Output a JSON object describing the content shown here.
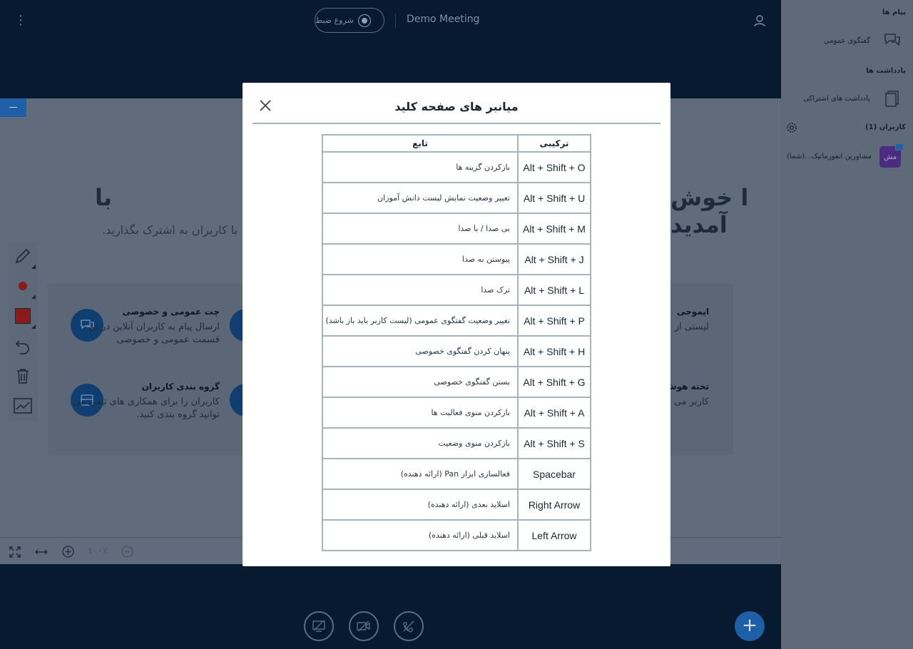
{
  "header": {
    "meeting_title": "Demo Meeting",
    "record_label": "شروع ضبط"
  },
  "stage": {
    "minimize_label": "—",
    "welcome_left": "با",
    "welcome_right": "ا خوش آمدید",
    "welcome_sub": "با کاربران به اشترک بگذارید.",
    "features": {
      "chat_title": "چت عمومی و خصوصی",
      "chat_text": "ارسال پیام به کاربران آنلاین در دو قسمت عمومی و خصوصی",
      "group_title": "گروه بندی کاربران",
      "group_text": "کاربران را برای همکاری های تیمی می توانید گروه بندی کنید.",
      "emoji_title": "ایموجی",
      "emoji_text": "لیستی از ... مختلف ... وضعیت ک...",
      "board_title": "تخته هوش...",
      "board_text": "کاربر می ... همزمان ... محتوایی ..."
    }
  },
  "zoombar": {
    "zoom_value": "۱۰۰٪"
  },
  "panel": {
    "messages_header": "پیام ها",
    "public_chat": "گفتگوی عمومی",
    "notes_header": "یادداشت ها",
    "shared_notes": "یادداشت های اشتراکی",
    "users_header": "کاربران (1)",
    "user_name": "مشاورین انفورماتیک...(شما)",
    "user_initials": "مش"
  },
  "modal": {
    "title": "میانبر های صفحه کلید",
    "col_combo": "ترکیبی",
    "col_function": "تابع",
    "rows": [
      {
        "combo": "Alt + Shift + O",
        "func": "بازکردن گزینه ها"
      },
      {
        "combo": "Alt + Shift + U",
        "func": "تغییر وضعیت نمایش لیست دانش آموزان"
      },
      {
        "combo": "Alt + Shift + M",
        "func": "بی صدا / با صدا"
      },
      {
        "combo": "Alt + Shift + J",
        "func": "پیوستن به صدا"
      },
      {
        "combo": "Alt + Shift + L",
        "func": "ترک صدا"
      },
      {
        "combo": "Alt + Shift + P",
        "func": "تغییر وضعیت گفتگوی عمومی (لیست کاربر باید باز باشد)"
      },
      {
        "combo": "Alt + Shift + H",
        "func": "پنهان کردن گفتگوی خصوصی"
      },
      {
        "combo": "Alt + Shift + G",
        "func": "بستن گفتگوی خصوصی"
      },
      {
        "combo": "Alt + Shift + A",
        "func": "بازکردن منوی فعالیت ها"
      },
      {
        "combo": "Alt + Shift + S",
        "func": "بازکردن منوی وضعیت"
      },
      {
        "combo": "Spacebar",
        "func": "فعالسازی ابزار Pan (ارائه دهنده)"
      },
      {
        "combo": "Right Arrow",
        "func": "اسلاید بعدی (ارائه دهنده)"
      },
      {
        "combo": "Left Arrow",
        "func": "اسلاید قبلی (ارائه دهنده)"
      }
    ]
  },
  "colors": {
    "navy": "#071a30",
    "accent": "#1f5fa8",
    "panel": "#5f6a79"
  }
}
